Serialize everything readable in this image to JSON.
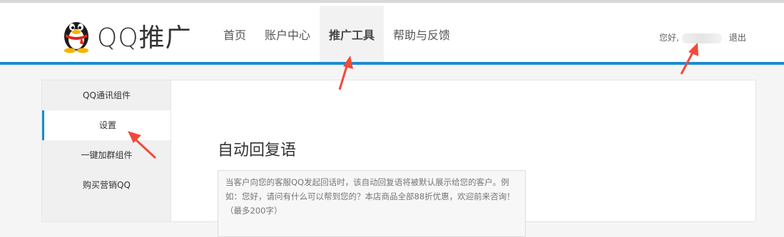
{
  "header": {
    "brand": "QQ推广",
    "nav": [
      {
        "label": "首页",
        "active": false
      },
      {
        "label": "账户中心",
        "active": false
      },
      {
        "label": "推广工具",
        "active": true
      },
      {
        "label": "帮助与反馈",
        "active": false
      }
    ],
    "greeting": "您好,",
    "logout": "退出"
  },
  "sidebar": {
    "items": [
      {
        "label": "QQ通讯组件",
        "active": false
      },
      {
        "label": "设置",
        "active": true
      },
      {
        "label": "一键加群组件",
        "active": false
      },
      {
        "label": "购买营销QQ",
        "active": false
      }
    ]
  },
  "main": {
    "title": "自动回复语",
    "reply_placeholder": "当客户向您的客服QQ发起回话时，该自动回复语将被默认展示给您的客户。例如：您好，请问有什么可以帮到您的？本店商品全部88折优惠，欢迎前来咨询！（最多200字）"
  },
  "colors": {
    "accent": "#1a8ccf",
    "annotation_arrow": "#f04b3a"
  }
}
